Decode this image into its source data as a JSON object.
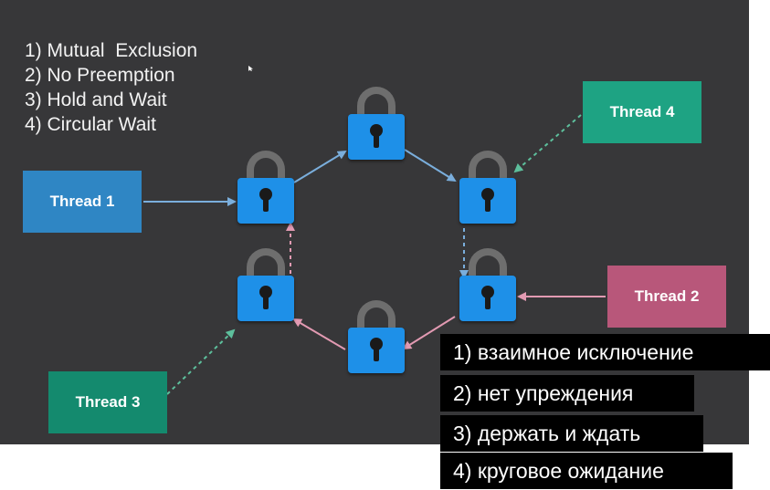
{
  "conditions": [
    "1) Mutual  Exclusion",
    "2) No Preemption",
    "3) Hold and Wait",
    "4) Circular Wait"
  ],
  "threads": {
    "thread_1": {
      "label": "Thread 1",
      "color": "#2f86c4"
    },
    "thread_2": {
      "label": "Thread 2",
      "color": "#b8577a"
    },
    "thread_3": {
      "label": "Thread 3",
      "color": "#148a6e"
    },
    "thread_4": {
      "label": "Thread 4",
      "color": "#1ea383"
    }
  },
  "colors": {
    "slide_background": "#373739",
    "lock_body": "#1e90e8",
    "lock_shackle": "#6e6e6e",
    "arrow_blue": "#7aaedc",
    "arrow_pink": "#e29ab2",
    "arrow_green": "#5dbf9c",
    "caption_background": "#000000"
  },
  "icons": [
    "padlock-icon",
    "arrow-icon",
    "cursor-icon"
  ],
  "translations": [
    "1) взаимное исключение",
    "2) нет упреждения",
    "3) держать и ждать",
    "4) круговое ожидание"
  ]
}
